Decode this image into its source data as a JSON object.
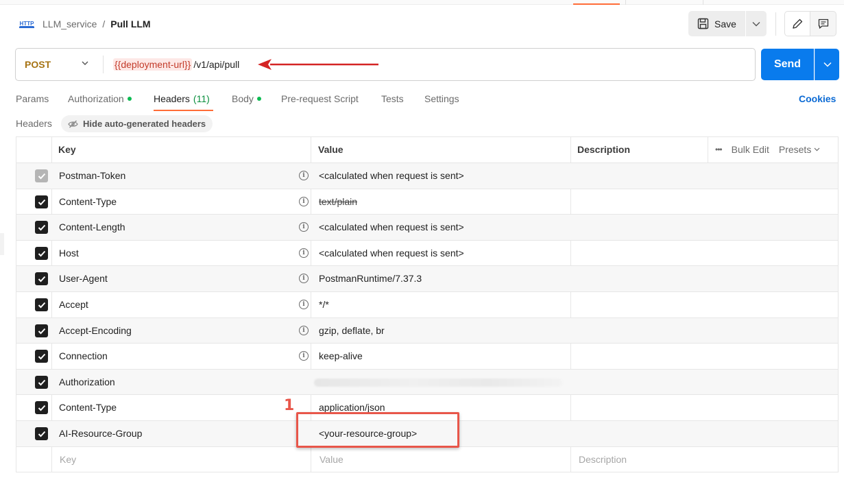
{
  "breadcrumb": {
    "icon": "http-icon",
    "icon_text": "HTTP",
    "parent": "LLM_service",
    "separator": "/",
    "current": "Pull LLM"
  },
  "toolbar": {
    "save_label": "Save"
  },
  "request": {
    "method": "POST",
    "url_variable": "{{deployment-url}}",
    "url_path": "/v1/api/pull",
    "send_label": "Send"
  },
  "tabs": [
    {
      "label": "Params",
      "dot": false
    },
    {
      "label": "Authorization",
      "dot": true
    },
    {
      "label": "Headers",
      "count": "(11)",
      "active": true
    },
    {
      "label": "Body",
      "dot": true
    },
    {
      "label": "Pre-request Script"
    },
    {
      "label": "Tests"
    },
    {
      "label": "Settings"
    }
  ],
  "cookies_label": "Cookies",
  "headers_section": {
    "label": "Headers",
    "hide_chip": "Hide auto-generated headers"
  },
  "table": {
    "columns": {
      "key": "Key",
      "value": "Value",
      "description": "Description"
    },
    "actions": {
      "more": "•••",
      "bulk_edit": "Bulk Edit",
      "presets": "Presets"
    },
    "rows": [
      {
        "key": "Postman-Token",
        "value": "<calculated when request is sent>",
        "checked": true,
        "disabled": true,
        "info": true
      },
      {
        "key": "Content-Type",
        "value": "text/plain",
        "checked": true,
        "info": true,
        "strike": true
      },
      {
        "key": "Content-Length",
        "value": "<calculated when request is sent>",
        "checked": true,
        "info": true
      },
      {
        "key": "Host",
        "value": "<calculated when request is sent>",
        "checked": true,
        "info": true
      },
      {
        "key": "User-Agent",
        "value": "PostmanRuntime/7.37.3",
        "checked": true,
        "info": true
      },
      {
        "key": "Accept",
        "value": "*/*",
        "checked": true,
        "info": true
      },
      {
        "key": "Accept-Encoding",
        "value": "gzip, deflate, br",
        "checked": true,
        "info": true
      },
      {
        "key": "Connection",
        "value": "keep-alive",
        "checked": true,
        "info": true
      },
      {
        "key": "Authorization",
        "value": "",
        "checked": true,
        "blurred": true
      },
      {
        "key": "Content-Type",
        "value": "application/json",
        "checked": true
      },
      {
        "key": "AI-Resource-Group",
        "value": "<your-resource-group>",
        "checked": true
      }
    ],
    "new_row": {
      "key": "Key",
      "value": "Value",
      "description": "Description"
    }
  },
  "annotation": {
    "number": "1"
  },
  "colors": {
    "accent": "#ff6c37",
    "send": "#097bed",
    "method": "#a67313",
    "annotation": "#e8564a",
    "dot": "#0cbb52"
  }
}
